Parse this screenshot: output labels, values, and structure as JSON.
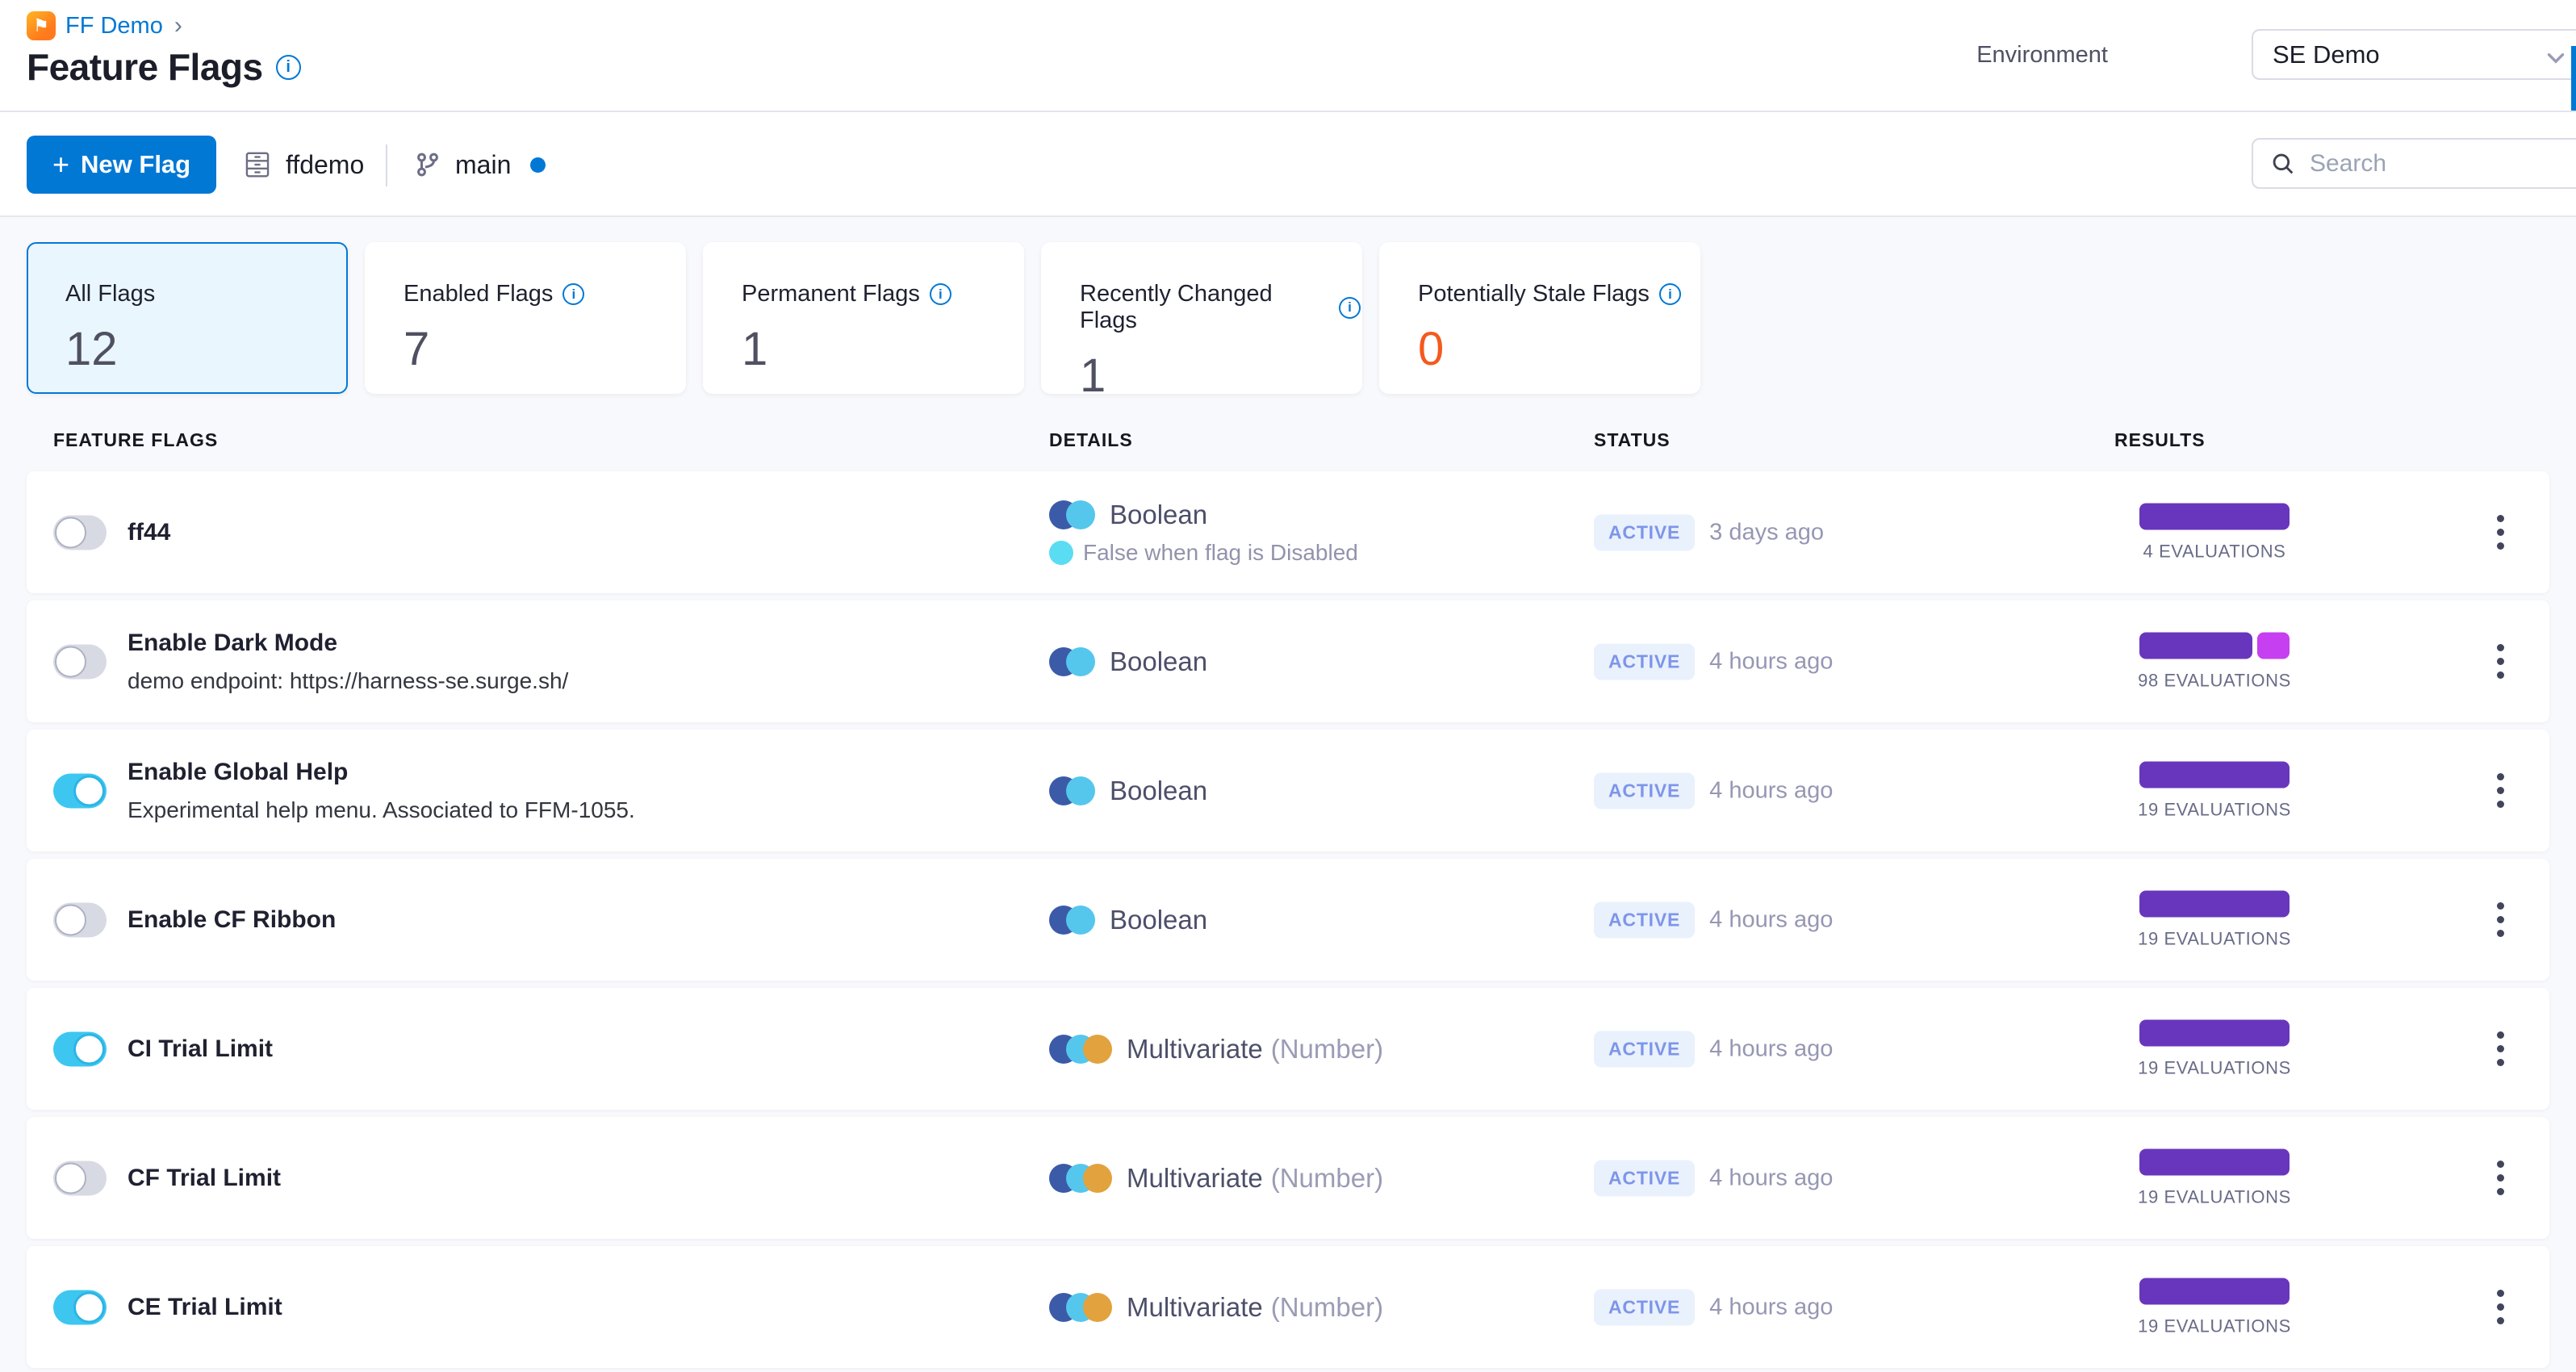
{
  "breadcrumb": {
    "project": "FF Demo",
    "chevron": "›"
  },
  "page": {
    "title": "Feature Flags"
  },
  "environment": {
    "label": "Environment",
    "value": "SE Demo"
  },
  "toolbar": {
    "new_flag_plus": "+",
    "new_flag_label": "New Flag",
    "repo_name": "ffdemo",
    "branch_name": "main",
    "search_placeholder": "Search"
  },
  "stat_cards": [
    {
      "label": "All Flags",
      "value": "12",
      "info": false,
      "selected": true,
      "value_color": "#4f5162"
    },
    {
      "label": "Enabled Flags",
      "value": "7",
      "info": true,
      "selected": false,
      "value_color": "#4f5162"
    },
    {
      "label": "Permanent Flags",
      "value": "1",
      "info": true,
      "selected": false,
      "value_color": "#4f5162"
    },
    {
      "label": "Recently Changed Flags",
      "value": "1",
      "info": true,
      "selected": false,
      "value_color": "#4f5162"
    },
    {
      "label": "Potentially Stale Flags",
      "value": "0",
      "info": true,
      "selected": false,
      "value_color": "#f4591e"
    }
  ],
  "table_headers": [
    "FEATURE FLAGS",
    "DETAILS",
    "STATUS",
    "RESULTS"
  ],
  "flags": [
    {
      "name": "ff44",
      "description": "",
      "enabled": false,
      "type": "Boolean",
      "type_suffix": "",
      "type_icon_colors": [
        "#3b5ba8",
        "#55c7ec"
      ],
      "note": "False when flag is Disabled",
      "status": "ACTIVE",
      "updated": "3 days ago",
      "evaluations": "4 EVALUATIONS",
      "bar_segments": [
        {
          "color": "#6836bc",
          "width": 186
        }
      ]
    },
    {
      "name": "Enable Dark Mode",
      "description": "demo endpoint: https://harness-se.surge.sh/",
      "enabled": false,
      "type": "Boolean",
      "type_suffix": "",
      "type_icon_colors": [
        "#3b5ba8",
        "#55c7ec"
      ],
      "note": "",
      "status": "ACTIVE",
      "updated": "4 hours ago",
      "evaluations": "98 EVALUATIONS",
      "bar_segments": [
        {
          "color": "#6836bc",
          "width": 140
        },
        {
          "color": "#c63ff0",
          "width": 40
        }
      ]
    },
    {
      "name": "Enable Global Help",
      "description": "Experimental help menu. Associated to FFM-1055.",
      "enabled": true,
      "type": "Boolean",
      "type_suffix": "",
      "type_icon_colors": [
        "#3b5ba8",
        "#55c7ec"
      ],
      "note": "",
      "status": "ACTIVE",
      "updated": "4 hours ago",
      "evaluations": "19 EVALUATIONS",
      "bar_segments": [
        {
          "color": "#6836bc",
          "width": 186
        }
      ]
    },
    {
      "name": "Enable CF Ribbon",
      "description": "",
      "enabled": false,
      "type": "Boolean",
      "type_suffix": "",
      "type_icon_colors": [
        "#3b5ba8",
        "#55c7ec"
      ],
      "note": "",
      "status": "ACTIVE",
      "updated": "4 hours ago",
      "evaluations": "19 EVALUATIONS",
      "bar_segments": [
        {
          "color": "#6836bc",
          "width": 186
        }
      ]
    },
    {
      "name": "CI Trial Limit",
      "description": "",
      "enabled": true,
      "type": "Multivariate",
      "type_suffix": "(Number)",
      "type_icon_colors": [
        "#3b5ba8",
        "#55c7ec",
        "#e2a23d"
      ],
      "note": "",
      "status": "ACTIVE",
      "updated": "4 hours ago",
      "evaluations": "19 EVALUATIONS",
      "bar_segments": [
        {
          "color": "#6836bc",
          "width": 186
        }
      ]
    },
    {
      "name": "CF Trial Limit",
      "description": "",
      "enabled": false,
      "type": "Multivariate",
      "type_suffix": "(Number)",
      "type_icon_colors": [
        "#3b5ba8",
        "#55c7ec",
        "#e2a23d"
      ],
      "note": "",
      "status": "ACTIVE",
      "updated": "4 hours ago",
      "evaluations": "19 EVALUATIONS",
      "bar_segments": [
        {
          "color": "#6836bc",
          "width": 186
        }
      ]
    },
    {
      "name": "CE Trial Limit",
      "description": "",
      "enabled": true,
      "type": "Multivariate",
      "type_suffix": "(Number)",
      "type_icon_colors": [
        "#3b5ba8",
        "#55c7ec",
        "#e2a23d"
      ],
      "note": "",
      "status": "ACTIVE",
      "updated": "4 hours ago",
      "evaluations": "19 EVALUATIONS",
      "bar_segments": [
        {
          "color": "#6836bc",
          "width": 186
        }
      ]
    }
  ],
  "colors": {
    "primary_blue": "#0278d5",
    "toggle_on": "#3dc7f0",
    "bar_purple": "#6836bc",
    "bar_magenta": "#c63ff0",
    "badge_bg": "#e9f1fd",
    "badge_text": "#7e95e9",
    "stale_orange": "#f4591e",
    "page_bg": "#f8f9fc"
  }
}
